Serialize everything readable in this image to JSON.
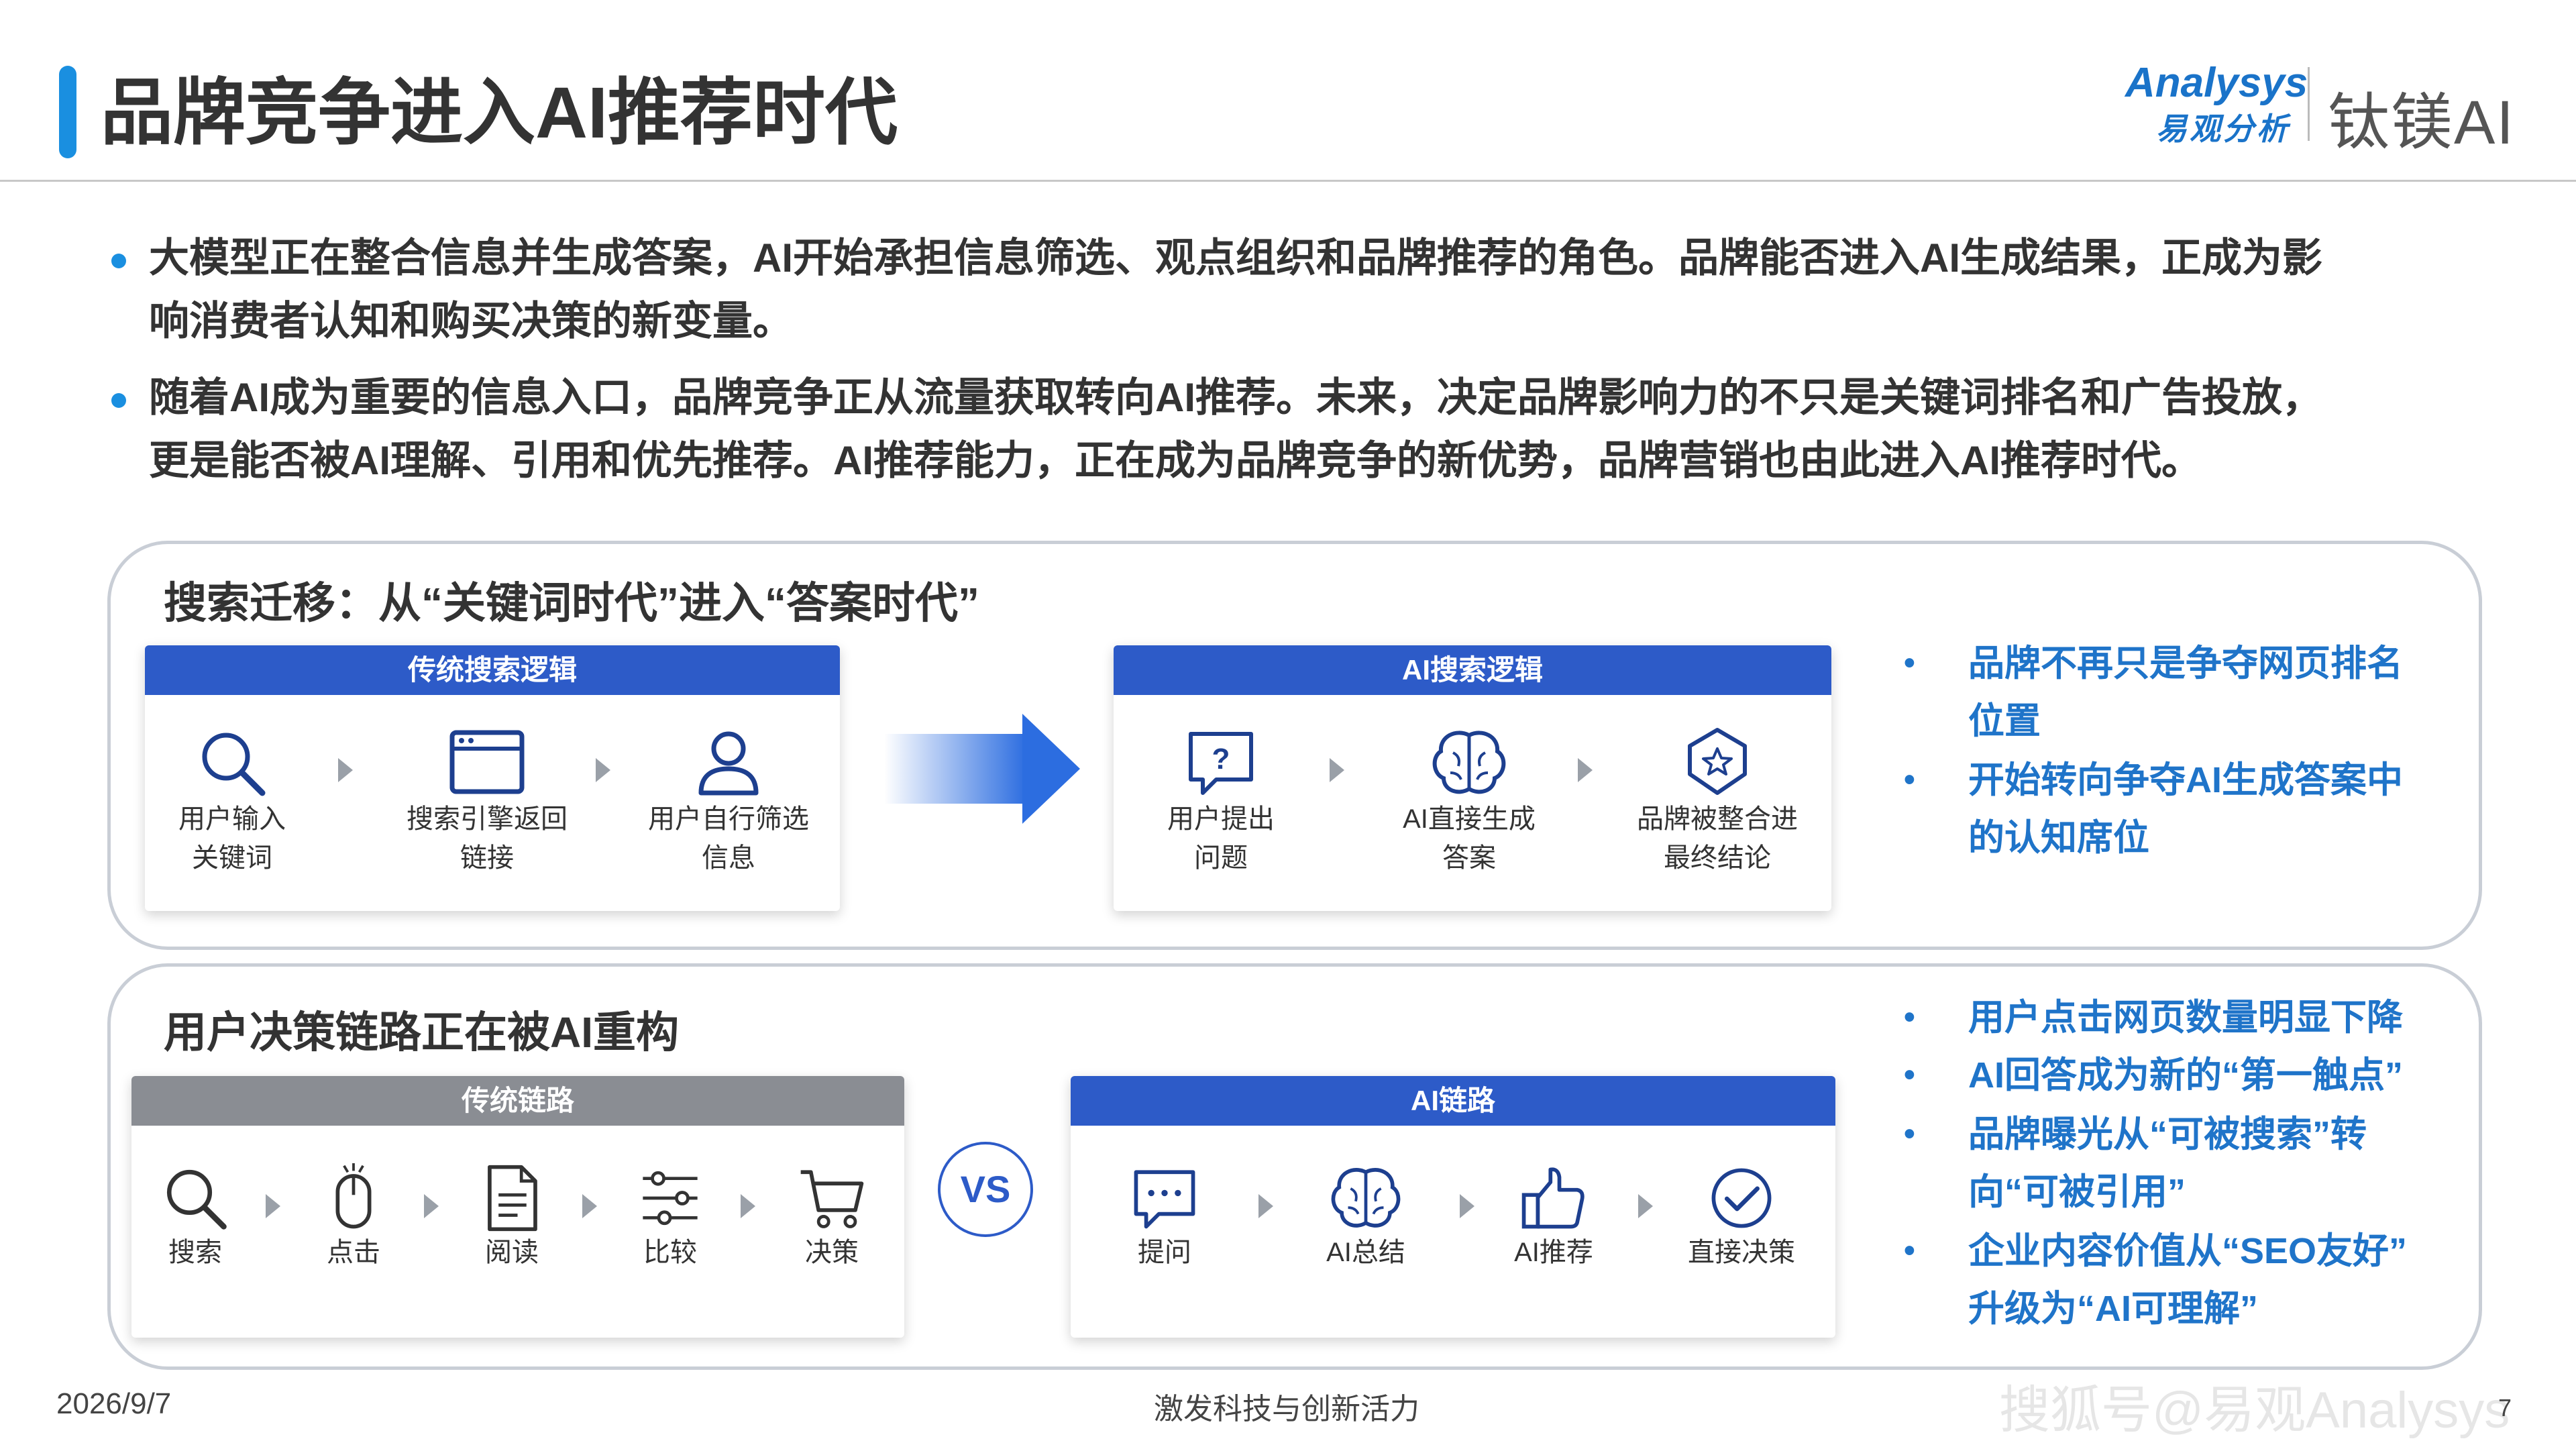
{
  "header": {
    "title": "品牌竞争进入AI推荐时代",
    "logo_analysys": "Analysys",
    "logo_analysys_cn": "易观分析",
    "logo_taimei": "钛镁AI"
  },
  "bullets": [
    {
      "line1": "大模型正在整合信息并生成答案，AI开始承担信息筛选、观点组织和品牌推荐的角色。品牌能否进入AI生成结果，正成为影",
      "line2": "响消费者认知和购买决策的新变量。"
    },
    {
      "line1": "随着AI成为重要的信息入口，品牌竞争正从流量获取转向AI推荐。未来，决定品牌影响力的不只是关键词排名和广告投放，",
      "line2": "更是能否被AI理解、引用和优先推荐。AI推荐能力，正在成为品牌竞争的新优势，品牌营销也由此进入AI推荐时代。"
    }
  ],
  "panel1": {
    "title": "搜索迁移：从“关键词时代”进入“答案时代”",
    "left_box": {
      "header": "传统搜索逻辑",
      "steps": [
        {
          "icon": "search-icon",
          "label": "用户输入\n关键词"
        },
        {
          "icon": "browser-window-icon",
          "label": "搜索引擎返回\n链接"
        },
        {
          "icon": "user-icon",
          "label": "用户自行筛选\n信息"
        }
      ]
    },
    "right_box": {
      "header": "AI搜索逻辑",
      "steps": [
        {
          "icon": "question-bubble-icon",
          "label": "用户提出\n问题"
        },
        {
          "icon": "brain-icon",
          "label": "AI直接生成\n答案"
        },
        {
          "icon": "star-badge-icon",
          "label": "品牌被整合进\n最终结论"
        }
      ]
    },
    "side_points": [
      {
        "line1": "品牌不再只是争夺网页排名",
        "line2": "位置"
      },
      {
        "line1": "开始转向争夺AI生成答案中",
        "line2": "的认知席位"
      }
    ]
  },
  "panel2": {
    "title": "用户决策链路正在被AI重构",
    "left_box": {
      "header": "传统链路",
      "steps": [
        {
          "icon": "search-icon",
          "label": "搜索"
        },
        {
          "icon": "mouse-icon",
          "label": "点击"
        },
        {
          "icon": "document-icon",
          "label": "阅读"
        },
        {
          "icon": "sliders-icon",
          "label": "比较"
        },
        {
          "icon": "cart-icon",
          "label": "决策"
        }
      ]
    },
    "vs": "VS",
    "right_box": {
      "header": "AI链路",
      "steps": [
        {
          "icon": "chat-bubble-icon",
          "label": "提问"
        },
        {
          "icon": "brain-icon",
          "label": "AI总结"
        },
        {
          "icon": "thumbs-up-icon",
          "label": "AI推荐"
        },
        {
          "icon": "check-circle-icon",
          "label": "直接决策"
        }
      ]
    },
    "side_points": [
      {
        "line1": "用户点击网页数量明显下降",
        "line2": ""
      },
      {
        "line1": "AI回答成为新的“第一触点”",
        "line2": ""
      },
      {
        "line1": "品牌曝光从“可被搜索”转",
        "line2": "向“可被引用”"
      },
      {
        "line1": "企业内容价值从“SEO友好”",
        "line2": "升级为“AI可理解”"
      }
    ]
  },
  "footer": {
    "date": "2026/9/7",
    "center": "激发科技与创新活力",
    "watermark": "搜狐号@易观Analysys",
    "page": "7"
  },
  "colors": {
    "accent": "#1a8fe0",
    "box_header_blue": "#2d5bc8",
    "box_header_gray": "#8a8d93",
    "side_text": "#1f74c9"
  }
}
